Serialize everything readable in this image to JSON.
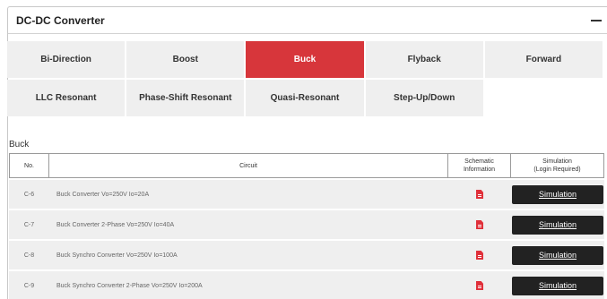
{
  "panel": {
    "title": "DC-DC Converter"
  },
  "tabs": [
    {
      "label": "Bi-Direction",
      "active": false
    },
    {
      "label": "Boost",
      "active": false
    },
    {
      "label": "Buck",
      "active": true
    },
    {
      "label": "Flyback",
      "active": false
    },
    {
      "label": "Forward",
      "active": false
    },
    {
      "label": "LLC Resonant",
      "active": false
    },
    {
      "label": "Phase-Shift Resonant",
      "active": false
    },
    {
      "label": "Quasi-Resonant",
      "active": false
    },
    {
      "label": "Step-Up/Down",
      "active": false
    }
  ],
  "section": {
    "title": "Buck"
  },
  "table": {
    "headers": {
      "no": "No.",
      "circuit": "Circuit",
      "schematic_line1": "Schematic",
      "schematic_line2": "Information",
      "simulation_line1": "Simulation",
      "simulation_line2": "(Login Required)"
    },
    "rows": [
      {
        "no": "C-6",
        "circuit": "Buck Converter Vo=250V Io=20A",
        "sim_label": "Simulation"
      },
      {
        "no": "C-7",
        "circuit": "Buck Converter 2-Phase Vo=250V Io=40A",
        "sim_label": "Simulation"
      },
      {
        "no": "C-8",
        "circuit": "Buck Synchro Converter Vo=250V Io=100A",
        "sim_label": "Simulation"
      },
      {
        "no": "C-9",
        "circuit": "Buck Synchro Converter 2-Phase Vo=250V Io=200A",
        "sim_label": "Simulation"
      }
    ]
  },
  "colors": {
    "accent": "#d7363b",
    "button": "#222222",
    "tab_bg": "#efefef",
    "pdf_icon": "#e0303a"
  },
  "icons": {
    "collapse": "minus-icon",
    "schematic": "pdf-icon"
  }
}
